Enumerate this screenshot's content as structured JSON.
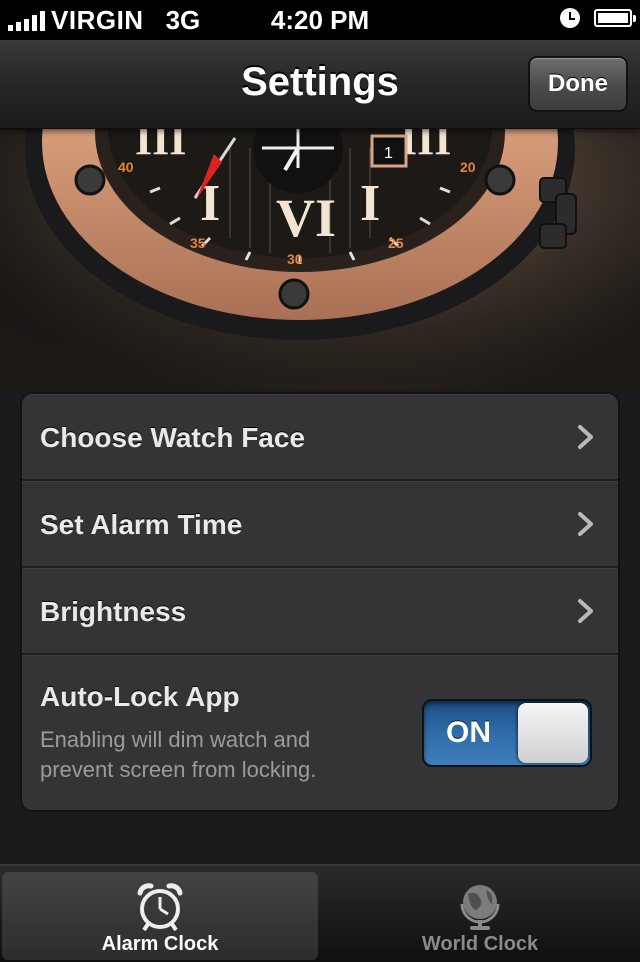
{
  "status_bar": {
    "carrier": "VIRGIN",
    "network": "3G",
    "time": "4:20 PM",
    "signal_bars": 5
  },
  "nav": {
    "title": "Settings",
    "done_label": "Done"
  },
  "settings": {
    "rows": [
      {
        "label": "Choose Watch Face",
        "icon": "chevron-right-icon"
      },
      {
        "label": "Set Alarm Time",
        "icon": "chevron-right-icon"
      },
      {
        "label": "Brightness",
        "icon": "chevron-right-icon"
      }
    ],
    "auto_lock": {
      "label": "Auto-Lock App",
      "description": "Enabling will dim watch and prevent screen from locking.",
      "toggle_label": "ON",
      "enabled": true
    }
  },
  "tabs": [
    {
      "label": "Alarm Clock",
      "icon": "alarm-clock-icon",
      "active": true
    },
    {
      "label": "World Clock",
      "icon": "globe-icon",
      "active": false
    }
  ],
  "colors": {
    "toggle_on": "#2f6ca8",
    "watch_bezel": "#d9a585"
  }
}
